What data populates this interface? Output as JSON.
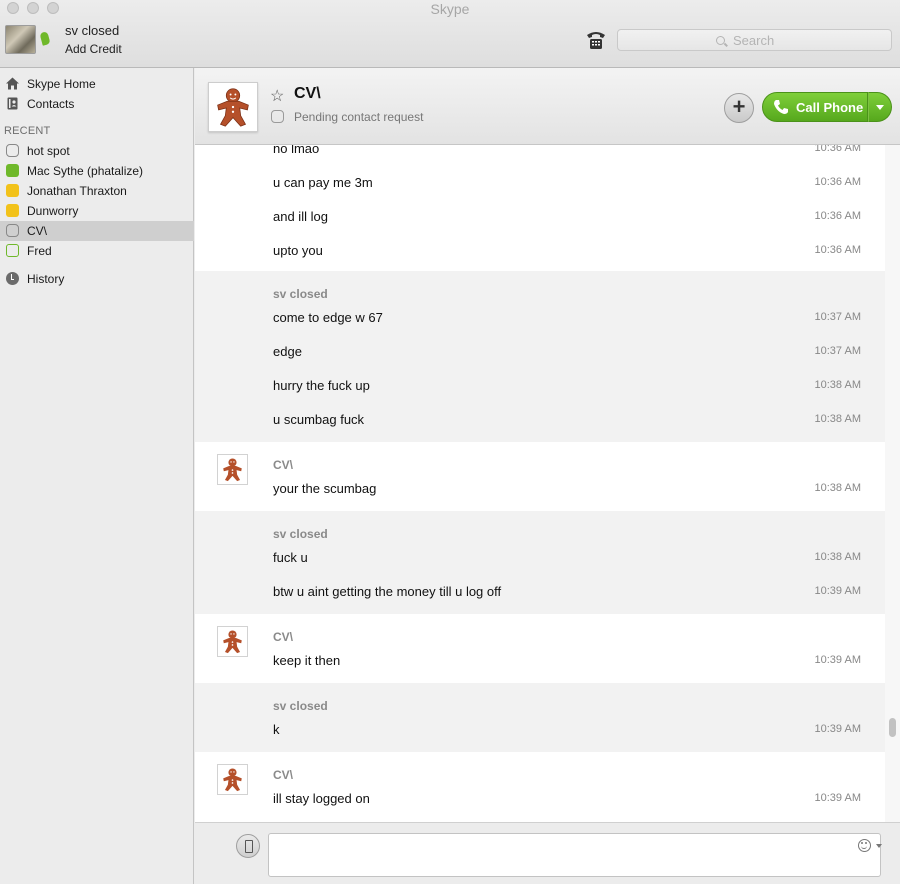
{
  "window": {
    "title": "Skype"
  },
  "profile": {
    "name": "sv closed",
    "add_credit": "Add Credit"
  },
  "search": {
    "placeholder": "Search"
  },
  "sidebar": {
    "nav": [
      {
        "label": "Skype Home",
        "icon": "home-icon"
      },
      {
        "label": "Contacts",
        "icon": "contacts-book-icon"
      }
    ],
    "recent_header": "RECENT",
    "recent": [
      {
        "label": "hot spot",
        "status": "pending"
      },
      {
        "label": "Mac Sythe (phatalize)",
        "status": "online"
      },
      {
        "label": "Jonathan Thraxton",
        "status": "away"
      },
      {
        "label": "Dunworry",
        "status": "away"
      },
      {
        "label": "CV\\",
        "status": "pending",
        "active": true
      },
      {
        "label": "Fred",
        "status": "offline-green"
      }
    ],
    "history": "History"
  },
  "conversation": {
    "name": "CV\\",
    "status_text": "Pending contact request",
    "call_label": "Call Phone"
  },
  "messages": [
    {
      "text": "no lmao",
      "time": "10:36 AM"
    },
    {
      "text": "u can pay me 3m",
      "time": "10:36 AM"
    },
    {
      "text": "and ill log",
      "time": "10:36 AM"
    },
    {
      "text": "upto you",
      "time": "10:36 AM"
    },
    {
      "sender": "sv closed"
    },
    {
      "text": "come to edge w 67",
      "time": "10:37 AM"
    },
    {
      "text": "edge",
      "time": "10:37 AM"
    },
    {
      "text": "hurry the fuck up",
      "time": "10:38 AM"
    },
    {
      "text": "u scumbag fuck",
      "time": "10:38 AM"
    },
    {
      "sender": "CV\\"
    },
    {
      "text": "your the scumbag",
      "time": "10:38 AM"
    },
    {
      "sender": "sv closed"
    },
    {
      "text": "fuck u",
      "time": "10:38 AM"
    },
    {
      "text": "btw u aint getting the money till u log off",
      "time": "10:39 AM"
    },
    {
      "sender": "CV\\"
    },
    {
      "text": "keep it then",
      "time": "10:39 AM"
    },
    {
      "sender": "sv closed"
    },
    {
      "text": "k",
      "time": "10:39 AM"
    },
    {
      "sender": "CV\\"
    },
    {
      "text": "ill stay logged on",
      "time": "10:39 AM"
    }
  ],
  "colors": {
    "call_green": "#5cb123",
    "selection": "#cfcfcf",
    "me_bubble": "#f2f2f2"
  }
}
